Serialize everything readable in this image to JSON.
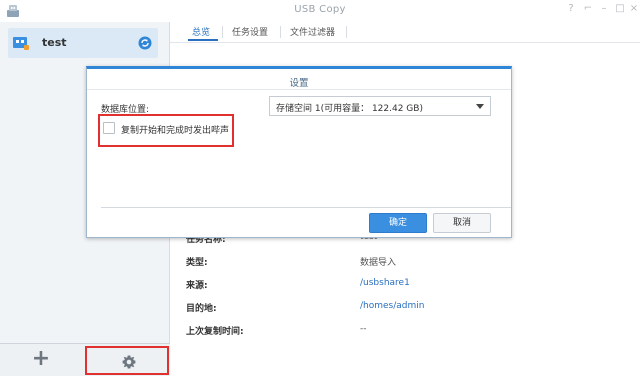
{
  "window": {
    "title": "USB Copy",
    "controls": [
      "help-icon",
      "pin-icon",
      "minimize-icon",
      "maximize-icon",
      "close-icon"
    ]
  },
  "sidebar": {
    "task": {
      "label": "test",
      "status_icon": "sync-icon",
      "icon": "usb-task-icon"
    },
    "footer": {
      "add_label": "+",
      "settings_icon": "gear-icon"
    }
  },
  "tabs": [
    {
      "label": "总览",
      "active": true
    },
    {
      "label": "任务设置",
      "active": false
    },
    {
      "label": "文件过滤器",
      "active": false
    }
  ],
  "info": {
    "rows": [
      {
        "key": "任务名称:",
        "value": "test"
      },
      {
        "key": "类型:",
        "value": "数据导入"
      },
      {
        "key": "来源:",
        "value": "/usbshare1"
      },
      {
        "key": "目的地:",
        "value": "/homes/admin"
      },
      {
        "key": "上次复制时间:",
        "value": "--"
      }
    ]
  },
  "dialog": {
    "title": "设置",
    "db_location_label": "数据库位置:",
    "db_location_value": "存储空间 1(可用容量： 122.42 GB)",
    "checkbox_label": "复制开始和完成时发出哔声",
    "checkbox_checked": false,
    "ok_label": "确定",
    "cancel_label": "取消"
  },
  "colors": {
    "accent": "#2f86d6",
    "highlight": "#e03030",
    "sidebar_bg": "#f1f4f7",
    "selected_bg": "#dbe9f7"
  }
}
